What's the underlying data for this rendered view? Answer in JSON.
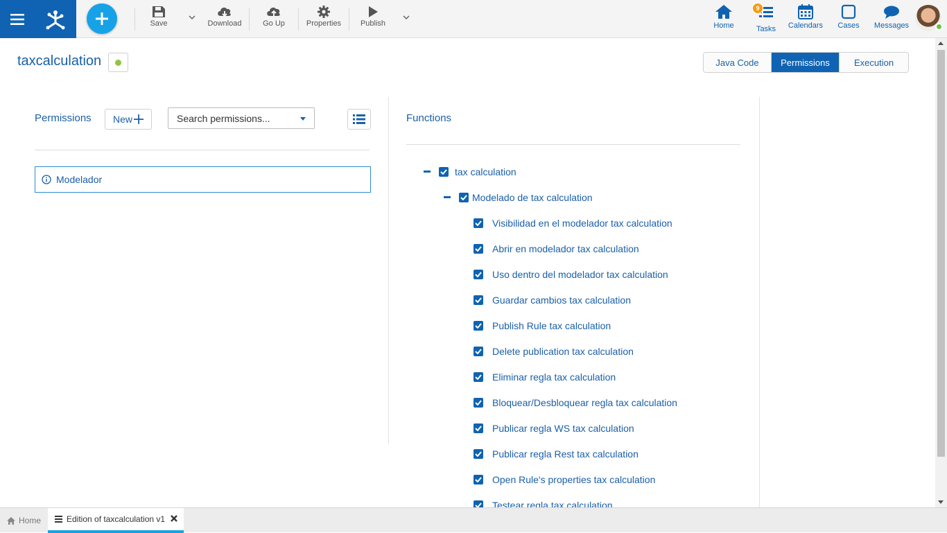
{
  "toolbar": {
    "save": "Save",
    "download": "Download",
    "go_up": "Go Up",
    "properties": "Properties",
    "publish": "Publish"
  },
  "nav": {
    "home": "Home",
    "tasks": "Tasks",
    "tasks_badge": "9",
    "calendars": "Calendars",
    "cases": "Cases",
    "messages": "Messages"
  },
  "header": {
    "title": "taxcalculation",
    "view_tabs": [
      "Java Code",
      "Permissions",
      "Execution"
    ],
    "active_view_tab": "Permissions"
  },
  "permissions": {
    "label": "Permissions",
    "new_label": "New",
    "search_placeholder": "Search permissions...",
    "items": [
      "Modelador"
    ]
  },
  "functions": {
    "label": "Functions",
    "root": "tax calculation",
    "group": "Modelado de tax calculation",
    "items": [
      "Visibilidad en el modelador tax calculation",
      "Abrir en modelador tax calculation",
      "Uso dentro del modelador tax calculation",
      "Guardar cambios tax calculation",
      "Publish Rule tax calculation",
      "Delete publication tax calculation",
      "Eliminar regla tax calculation",
      "Bloquear/Desbloquear regla tax calculation",
      "Publicar regla WS tax calculation",
      "Publicar regla Rest tax calculation",
      "Open Rule's properties tax calculation",
      "Testear regla tax calculation"
    ]
  },
  "bottom_tabs": {
    "home": "Home",
    "edition": "Edition of taxcalculation v1"
  },
  "colors": {
    "brand": "#0f63b2",
    "accent": "#17a2e8",
    "status_ok": "#8dc63f",
    "badge": "#f39c12"
  },
  "icons": [
    "menu-icon",
    "app-logo-icon",
    "plus-icon",
    "save-icon",
    "cloud-download-icon",
    "cloud-upload-icon",
    "gear-icon",
    "play-icon",
    "home-icon",
    "tasks-icon",
    "calendar-icon",
    "cases-icon",
    "chat-icon",
    "info-icon",
    "list-icon",
    "check-icon",
    "close-icon",
    "document-icon"
  ]
}
